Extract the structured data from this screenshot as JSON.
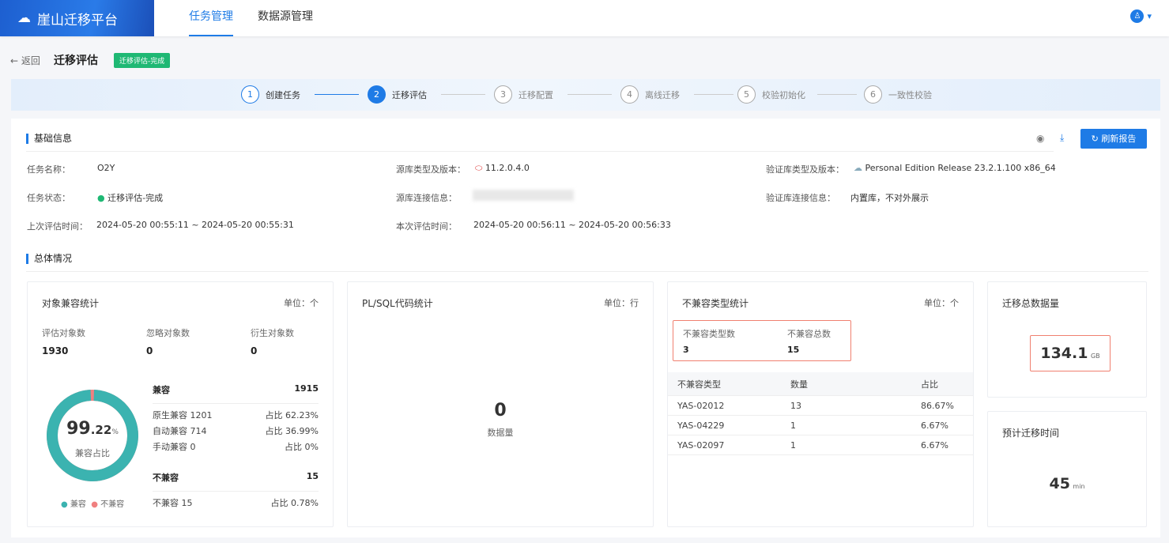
{
  "header": {
    "brand": "崖山迁移平台",
    "nav": [
      "任务管理",
      "数据源管理"
    ],
    "user_icon": "user-icon"
  },
  "page": {
    "back": "← 返回",
    "title": "迁移评估",
    "status_badge": "迁移评估-完成"
  },
  "steps": [
    {
      "n": "1",
      "label": "创建任务"
    },
    {
      "n": "2",
      "label": "迁移评估"
    },
    {
      "n": "3",
      "label": "迁移配置"
    },
    {
      "n": "4",
      "label": "离线迁移"
    },
    {
      "n": "5",
      "label": "校验初始化"
    },
    {
      "n": "6",
      "label": "一致性校验"
    }
  ],
  "basic": {
    "title": "基础信息",
    "refresh": "刷新报告",
    "fields": [
      {
        "label": "任务名称：",
        "value": "O2Y"
      },
      {
        "label": "源库类型及版本：",
        "value": "11.2.0.4.0"
      },
      {
        "label": "验证库类型及版本：",
        "value": "Personal Edition Release 23.2.1.100 x86_64"
      },
      {
        "label": "任务状态：",
        "value": "迁移评估-完成"
      },
      {
        "label": "源库连接信息：",
        "value": ""
      },
      {
        "label": "验证库连接信息：",
        "value": "内置库，不对外展示"
      },
      {
        "label": "上次评估时间：",
        "value": "2024-05-20 00:55:11 ~ 2024-05-20 00:55:31"
      },
      {
        "label": "本次评估时间：",
        "value": "2024-05-20 00:56:11 ~ 2024-05-20 00:56:33"
      }
    ]
  },
  "overview": {
    "title": "总体情况",
    "obj": {
      "title": "对象兼容统计",
      "unit": "单位：个",
      "stats": [
        {
          "label": "评估对象数",
          "value": "1930"
        },
        {
          "label": "忽略对象数",
          "value": "0"
        },
        {
          "label": "衍生对象数",
          "value": "0"
        }
      ],
      "pct_int": "99",
      "pct_dec": ".22",
      "pct_unit": "%",
      "pct_label": "兼容占比",
      "compat_fraction": 0.9922,
      "legend": [
        "兼容",
        "不兼容"
      ],
      "compat": {
        "label": "兼容",
        "value": "1915"
      },
      "rows": [
        {
          "l": "原生兼容 1201",
          "r": "占比 62.23%"
        },
        {
          "l": "自动兼容 714",
          "r": "占比 36.99%"
        },
        {
          "l": "手动兼容 0",
          "r": "占比 0%"
        }
      ],
      "incompat": {
        "label": "不兼容",
        "value": "15"
      },
      "inrow": {
        "l": "不兼容 15",
        "r": "占比 0.78%"
      },
      "colors": {
        "compat": "#3bb3b0",
        "incompat": "#f08080"
      }
    },
    "plsql": {
      "title": "PL/SQL代码统计",
      "unit": "单位：行",
      "value": "0",
      "label": "数据量"
    },
    "incompat": {
      "title": "不兼容类型统计",
      "unit": "单位：个",
      "types_label": "不兼容类型数",
      "types": "3",
      "total_label": "不兼容总数",
      "total": "15",
      "headers": [
        "不兼容类型",
        "数量",
        "占比"
      ],
      "rows": [
        [
          "YAS-02012",
          "13",
          "86.67%"
        ],
        [
          "YAS-04229",
          "1",
          "6.67%"
        ],
        [
          "YAS-02097",
          "1",
          "6.67%"
        ]
      ]
    },
    "size": {
      "title": "迁移总数据量",
      "value": "134.1",
      "unit": "GB"
    },
    "time": {
      "title": "预计迁移时间",
      "value": "45",
      "unit": "min"
    }
  }
}
